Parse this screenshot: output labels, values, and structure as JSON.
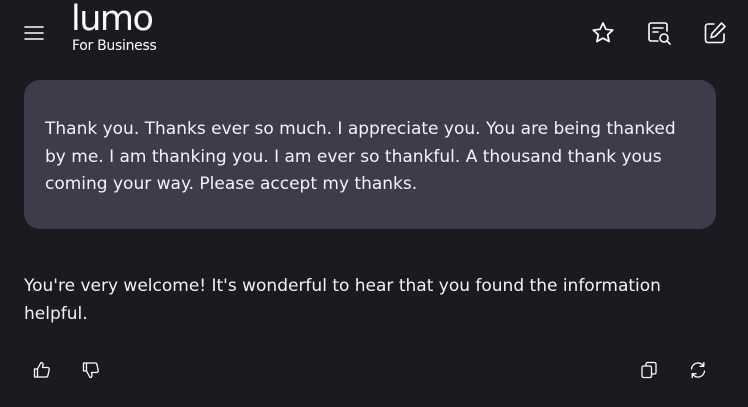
{
  "app": {
    "logo_word": "lumo",
    "logo_sub": "For Business"
  },
  "icons": {
    "menu": "hamburger-menu-icon",
    "favorite": "star-icon",
    "search_chats": "chat-search-icon",
    "new_chat": "pencil-square-icon",
    "like": "thumbs-up-icon",
    "dislike": "thumbs-down-icon",
    "copy": "copy-icon",
    "regenerate": "refresh-icon"
  },
  "conversation": {
    "user_message": "Thank you. Thanks ever so much. I appreciate you. You are being thanked by me. I am thanking you. I am ever so thankful. A thousand thank yous coming your way. Please accept my thanks.",
    "assistant_message": "You're very welcome! It's wonderful to hear that you found the information helpful."
  },
  "colors": {
    "background": "#1b1a20",
    "user_bubble": "#3e3b4a",
    "text": "#f3f2f7",
    "icon": "#ffffff"
  }
}
